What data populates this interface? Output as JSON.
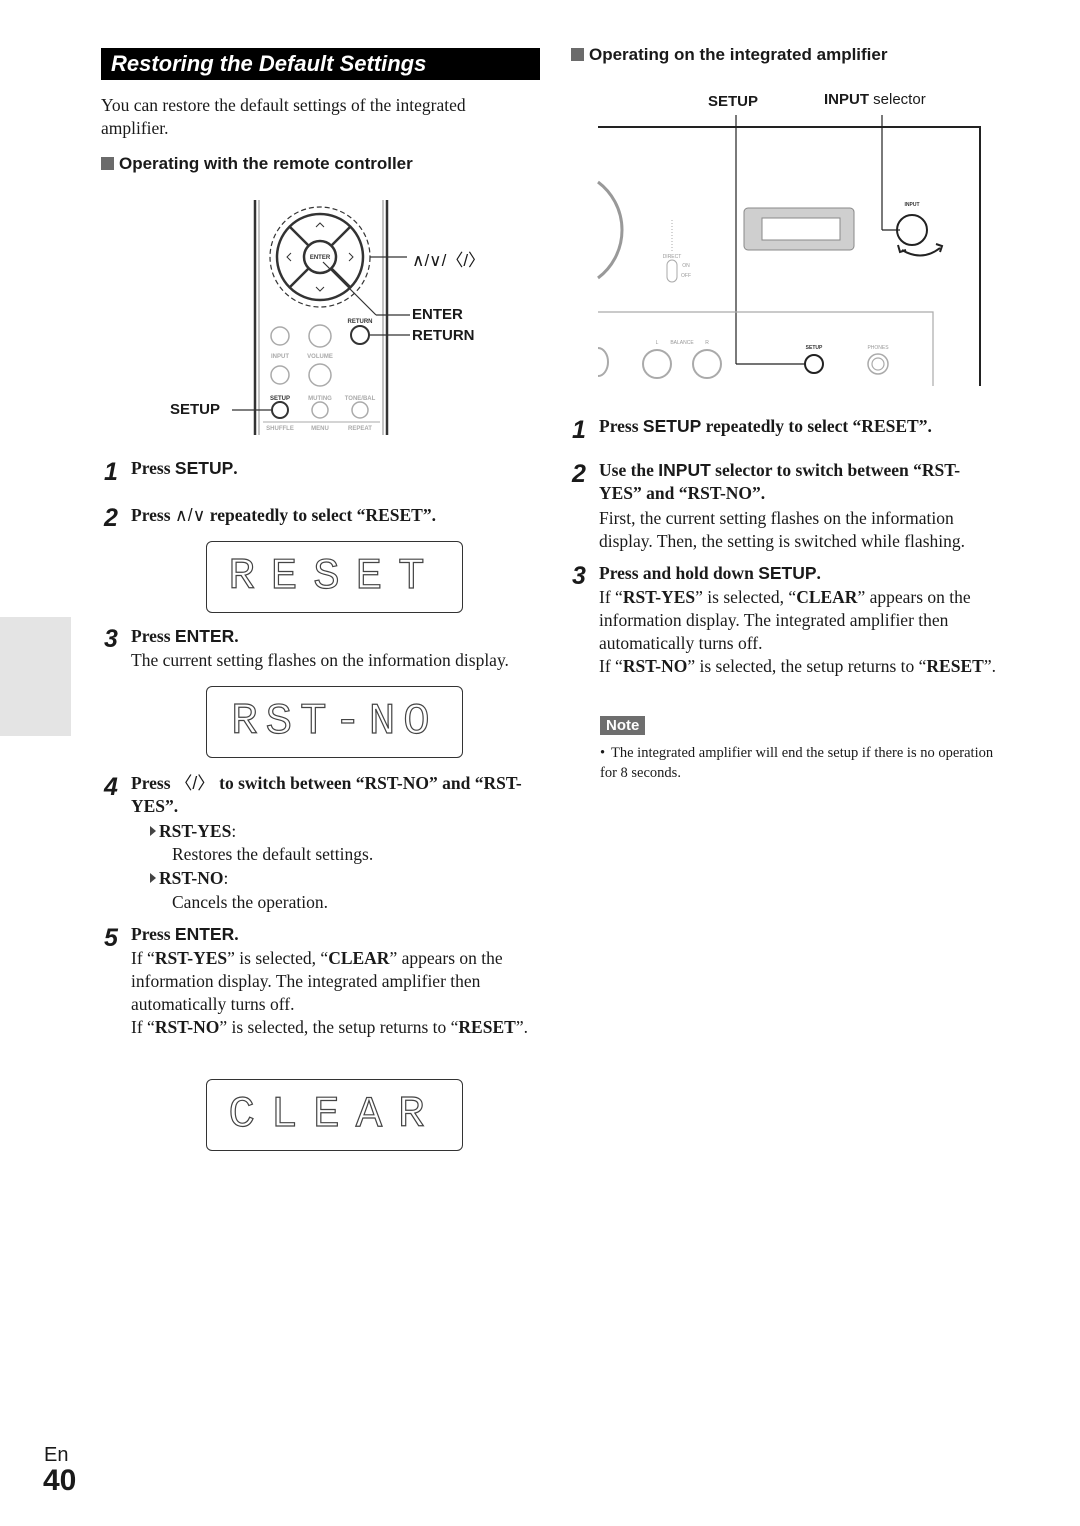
{
  "page": {
    "section_title": "Restoring the Default Settings",
    "intro": "You can restore the default settings of the integrated amplifier.",
    "language": "En",
    "page_number": "40"
  },
  "remote": {
    "heading": "Operating with the remote controller",
    "labels": {
      "arrows": "∧/∨/〈/〉",
      "enter": "ENTER",
      "return": "RETURN",
      "setup": "SETUP"
    },
    "remote_buttons": {
      "enter": "ENTER",
      "return": "RETURN",
      "input": "INPUT",
      "volume": "VOLUME",
      "setup": "SETUP",
      "muting": "MUTING",
      "tone_bal": "TONE/BAL",
      "shuffle": "SHUFFLE",
      "menu": "MENU",
      "repeat": "REPEAT"
    },
    "steps": [
      {
        "num": "1",
        "pre": "Press ",
        "key": "SETUP",
        "post": "."
      },
      {
        "num": "2",
        "pre": "Press ",
        "key": "∧/∨",
        "post": " repeatedly to select “RESET”.",
        "display": "RESET"
      },
      {
        "num": "3",
        "pre": "Press ",
        "key": "ENTER",
        "post": ".",
        "body": "The current setting flashes on the information display.",
        "display": "RST-NO"
      },
      {
        "num": "4",
        "pre": "Press ",
        "key": "〈/〉",
        "post": " to switch between “RST-NO” and “RST-YES”.",
        "options": [
          {
            "name": "RST-YES",
            "desc": "Restores the default settings."
          },
          {
            "name": "RST-NO",
            "desc": "Cancels the operation."
          }
        ]
      },
      {
        "num": "5",
        "pre": "Press ",
        "key": "ENTER",
        "post": ".",
        "body_a": "If “",
        "b1": "RST-YES",
        "body_b": "” is selected, “",
        "b2": "CLEAR",
        "body_c": "” appears on the information display. The integrated amplifier then automatically turns off.",
        "body_d": "If “",
        "b3": "RST-NO",
        "body_e": "” is selected, the setup returns to “",
        "b4": "RESET",
        "body_f": "”.",
        "display": "CLEAR"
      }
    ]
  },
  "amp": {
    "heading": "Operating on the integrated amplifier",
    "labels": {
      "setup": "SETUP",
      "input_bold": "INPUT",
      "input_rest": " selector"
    },
    "panel": {
      "input": "INPUT",
      "direct": "DIRECT",
      "on": "ON",
      "off": "OFF",
      "l": "L",
      "balance": "BALANCE",
      "r": "R",
      "setup": "SETUP",
      "phones": "PHONES"
    },
    "steps": [
      {
        "num": "1",
        "pre": "Press ",
        "key": "SETUP",
        "post": " repeatedly to select “RESET”."
      },
      {
        "num": "2",
        "pre": "Use the ",
        "key": "INPUT",
        "post": " selector to switch between “RST-YES” and “RST-NO”.",
        "body": "First, the current setting flashes on the information display. Then, the setting is switched while flashing."
      },
      {
        "num": "3",
        "pre": "Press and hold down ",
        "key": "SETUP",
        "post": ".",
        "body_a": "If “",
        "b1": "RST-YES",
        "body_b": "” is selected, “",
        "b2": "CLEAR",
        "body_c": "” appears on the information display. The integrated amplifier then automatically turns off.",
        "body_d": "If “",
        "b3": "RST-NO",
        "body_e": "” is selected, the setup returns to “",
        "b4": "RESET",
        "body_f": "”."
      }
    ],
    "note": {
      "label": "Note",
      "items": [
        "The integrated amplifier will end the setup if there is no operation for 8 seconds."
      ]
    }
  }
}
